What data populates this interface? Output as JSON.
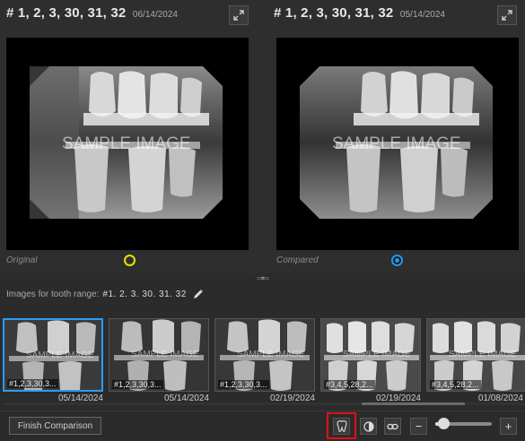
{
  "left_pane": {
    "title": "# 1, 2, 3, 30, 31, 32",
    "date": "06/14/2024",
    "watermark": "SAMPLE IMAGE",
    "label": "Original",
    "selected": false
  },
  "right_pane": {
    "title": "# 1, 2, 3, 30, 31, 32",
    "date": "05/14/2024",
    "watermark": "SAMPLE IMAGE",
    "label": "Compared",
    "selected": true
  },
  "range": {
    "label": "Images for tooth range:",
    "value": "#1. 2. 3. 30. 31. 32"
  },
  "thumbnails": [
    {
      "label": "#1,2,3,30,3...",
      "date": "05/14/2024",
      "watermark": "SAMPLE IMAGE",
      "selected": true
    },
    {
      "label": "#1,2,3,30,3...",
      "date": "05/14/2024",
      "watermark": "SAMPLE IMAGE",
      "selected": false
    },
    {
      "label": "#1,2,3,30,3...",
      "date": "02/19/2024",
      "watermark": "SAMPLE IMAGE",
      "selected": false
    },
    {
      "label": "#3,4,5,28,2...",
      "date": "02/19/2024",
      "watermark": "SAMPLE IMAGE",
      "selected": false
    },
    {
      "label": "#3,4,5,28,2...",
      "date": "01/08/2024",
      "watermark": "SAMPLE IMAGE",
      "selected": false
    }
  ],
  "toolbar": {
    "finish_label": "Finish Comparison",
    "zoom_minus": "−",
    "zoom_plus": "+",
    "zoom_level": 0.15,
    "icons": [
      "tooth-icon",
      "contrast-icon",
      "link-icon"
    ]
  },
  "colors": {
    "selected_border": "#2a9df4",
    "original_radio": "#e8e000",
    "compared_radio": "#1e9bf0",
    "highlight": "#e0101a"
  }
}
